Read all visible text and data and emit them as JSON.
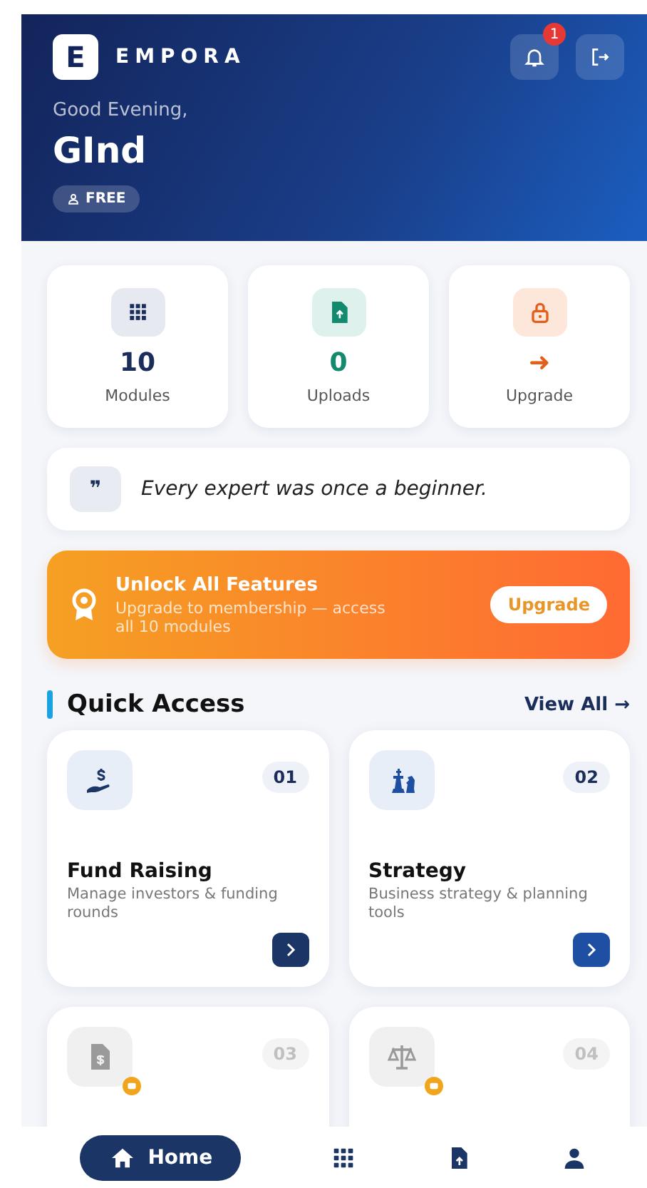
{
  "header": {
    "brand_letter": "E",
    "brand": "EMPORA",
    "notification_count": "1",
    "greeting": "Good Evening,",
    "user_name": "GInd",
    "plan": "FREE"
  },
  "stats": [
    {
      "value": "10",
      "label": "Modules",
      "color": "#1b2d5b"
    },
    {
      "value": "0",
      "label": "Uploads",
      "color": "#138a6e"
    },
    {
      "value": "➜",
      "label": "Upgrade",
      "color": "#e0601c"
    }
  ],
  "quote": {
    "mark": "❞",
    "text": "Every expert was once a beginner."
  },
  "banner": {
    "title": "Unlock All Features",
    "text": "Upgrade to membership — access all 10 modules",
    "button": "Upgrade"
  },
  "section": {
    "title": "Quick Access",
    "link": "View All →"
  },
  "modules": [
    {
      "number": "01",
      "title": "Fund Raising",
      "description": "Manage investors & funding rounds",
      "locked": false,
      "color": "#1b3566"
    },
    {
      "number": "02",
      "title": "Strategy",
      "description": "Business strategy & planning tools",
      "locked": false,
      "color": "#1f4fa3"
    },
    {
      "number": "03",
      "locked": true
    },
    {
      "number": "04",
      "locked": true
    }
  ],
  "nav": [
    {
      "label": "Home",
      "selected": true
    },
    {
      "selected": false
    },
    {
      "selected": false
    },
    {
      "selected": false
    }
  ]
}
